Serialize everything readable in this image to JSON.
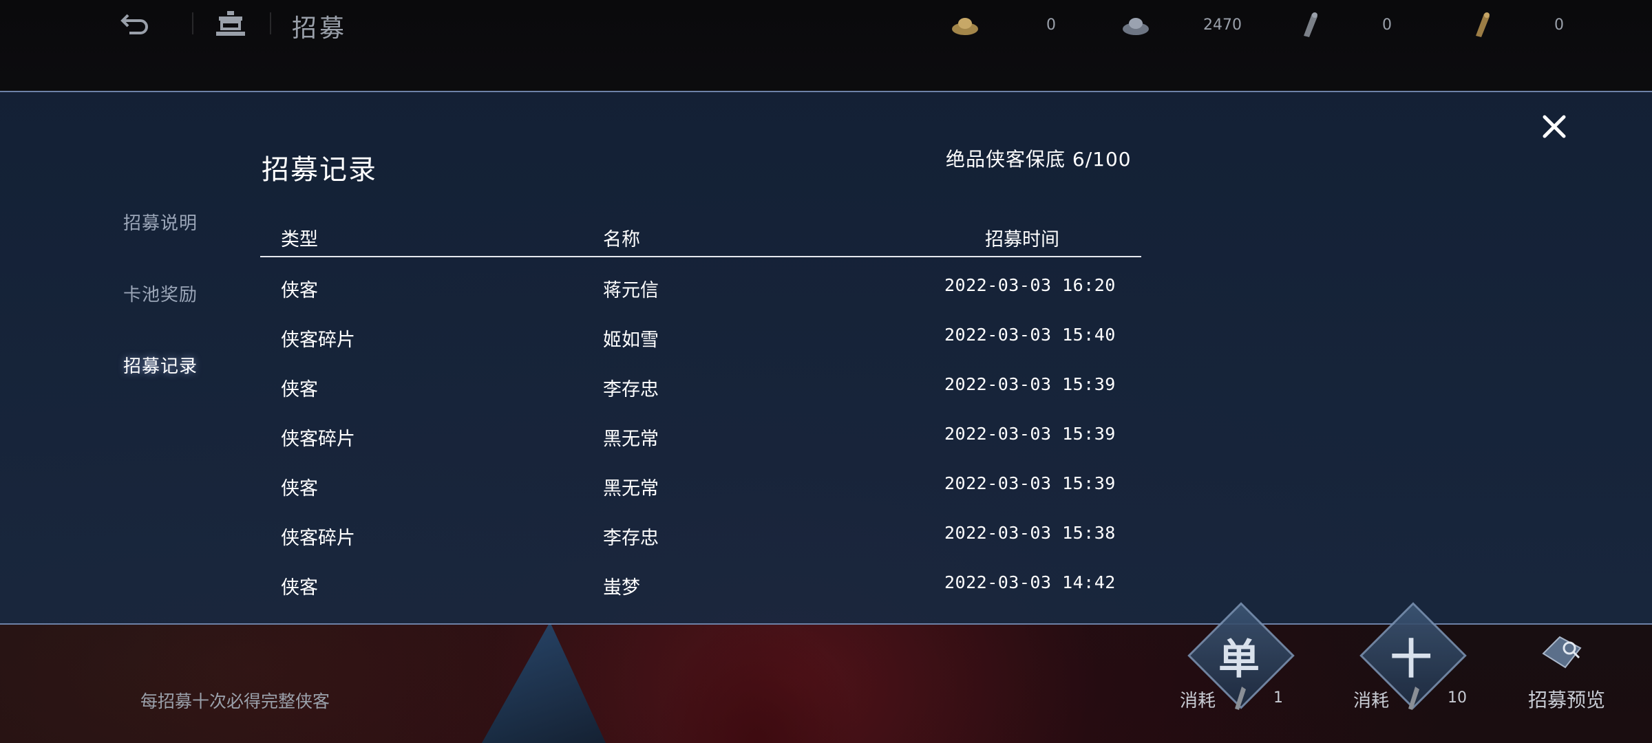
{
  "topbar": {
    "title": "招募",
    "resources": [
      {
        "icon": "gold-ingot-icon",
        "value": "0"
      },
      {
        "icon": "silver-ingot-icon",
        "value": "2470"
      },
      {
        "icon": "scroll-token-icon",
        "value": "0"
      },
      {
        "icon": "gold-scroll-token-icon",
        "value": "0"
      }
    ]
  },
  "sidebar": {
    "items": [
      {
        "label": "招募说明"
      },
      {
        "label": "卡池奖励"
      },
      {
        "label": "招募记录",
        "active": true
      }
    ]
  },
  "panel": {
    "title": "招募记录",
    "pity_text": "绝品侠客保底 6/100",
    "columns": [
      "类型",
      "名称",
      "招募时间"
    ],
    "rows": [
      {
        "type": "侠客",
        "name": "蒋元信",
        "time": "2022-03-03 16:20"
      },
      {
        "type": "侠客碎片",
        "name": "姬如雪",
        "time": "2022-03-03 15:40"
      },
      {
        "type": "侠客",
        "name": "李存忠",
        "time": "2022-03-03 15:39"
      },
      {
        "type": "侠客碎片",
        "name": "黑无常",
        "time": "2022-03-03 15:39"
      },
      {
        "type": "侠客",
        "name": "黑无常",
        "time": "2022-03-03 15:39"
      },
      {
        "type": "侠客碎片",
        "name": "李存忠",
        "time": "2022-03-03 15:38"
      },
      {
        "type": "侠客",
        "name": "蚩梦",
        "time": "2022-03-03 14:42"
      }
    ]
  },
  "bottom": {
    "hint": "每招募十次必得完整侠客",
    "single": {
      "glyph": "单",
      "cost_label": "消耗",
      "cost_value": "1"
    },
    "ten": {
      "glyph": "十",
      "cost_label": "消耗",
      "cost_value": "10"
    },
    "preview_label": "招募预览"
  },
  "colors": {
    "panel_bg": "#16243a",
    "accent_line": "#6d82a8",
    "text": "#ffffff",
    "muted": "#9ba6b8"
  }
}
